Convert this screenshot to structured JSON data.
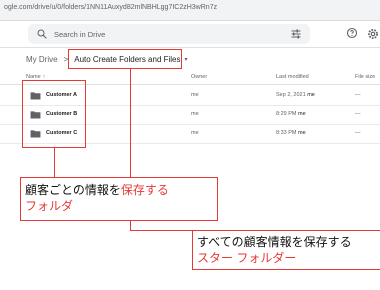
{
  "browser": {
    "url": "ogle.com/drive/u/0/folders/1NN11Auxyd82mlNBHLgg7IC2zH3wRn7z"
  },
  "drive": {
    "search_placeholder": "Search in Drive",
    "breadcrumb": {
      "root": "My Drive",
      "separator": ">",
      "current": "Auto Create Folders and Files",
      "dropdown": "▾"
    },
    "columns": {
      "name": "Name",
      "name_sort": "↑",
      "owner": "Owner",
      "modified": "Last modified",
      "size": "File size"
    },
    "rows": [
      {
        "name": "Customer A",
        "owner": "me",
        "modified": "Sep 2, 2021",
        "modified_by": "me",
        "size": "—"
      },
      {
        "name": "Customer B",
        "owner": "me",
        "modified": "8:29 PM",
        "modified_by": "me",
        "size": "—"
      },
      {
        "name": "Customer C",
        "owner": "me",
        "modified": "8:33 PM",
        "modified_by": "me",
        "size": "—"
      }
    ]
  },
  "annotations": {
    "callout_1": {
      "line1_black": "顧客ごとの情報を",
      "line1_red": "保存する",
      "line2_red": "フォルダ"
    },
    "callout_2": {
      "line1_black": "すべての顧客情報を保存する",
      "line2_red": "スター フォルダー"
    }
  },
  "colors": {
    "annotation_red": "#e53935",
    "folder_icon": "#5f6368",
    "search_bg": "#f1f3f4"
  },
  "icons": {
    "search": "search-icon",
    "tune": "tune-icon",
    "help": "help-icon",
    "settings": "settings-icon",
    "folder": "folder-icon"
  }
}
